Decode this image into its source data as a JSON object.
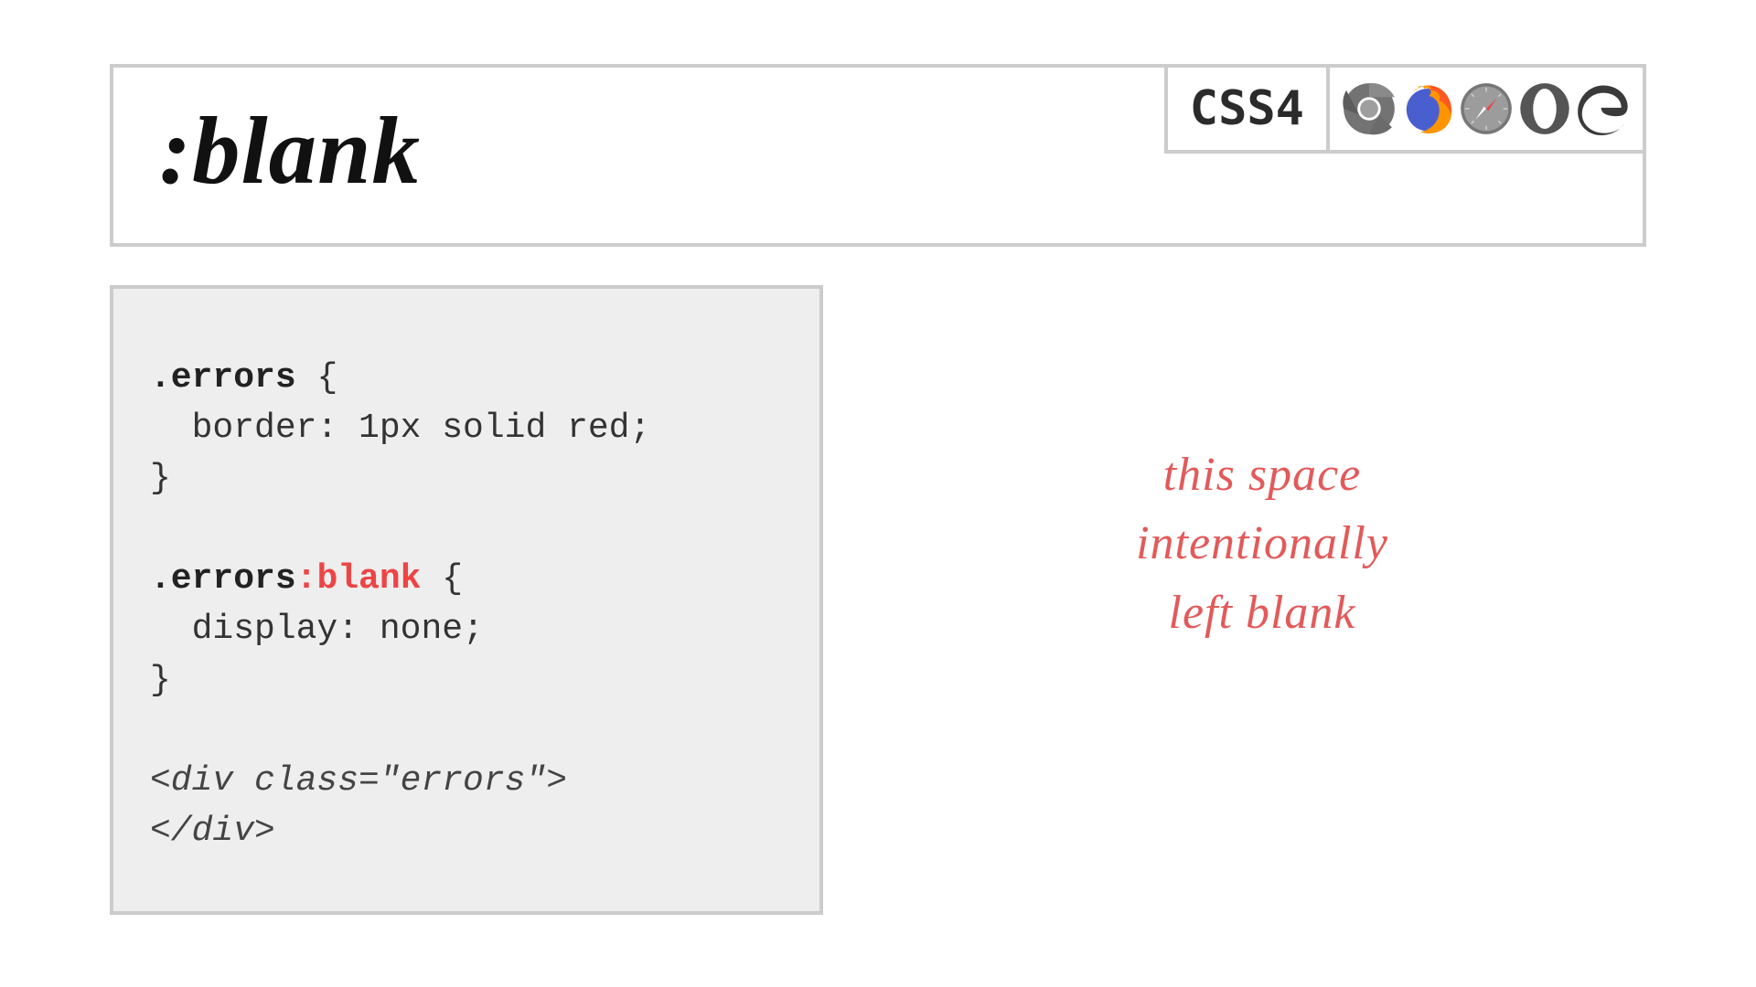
{
  "header": {
    "title": ":blank",
    "spec_badge": "CSS4",
    "browsers": [
      "chrome",
      "firefox",
      "safari",
      "opera",
      "edge"
    ]
  },
  "code": {
    "rule1_selector": ".errors",
    "rule1_body": "  border: 1px solid red;",
    "rule2_selector_prefix": ".errors",
    "rule2_selector_highlight": ":blank",
    "rule2_body": "  display: none;",
    "brace_open": " {",
    "brace_close": "}",
    "html_line1": "<div class=\"errors\">",
    "html_line2": "</div>"
  },
  "caption": {
    "line1": "this space",
    "line2": "intentionally",
    "line3": "left blank"
  }
}
